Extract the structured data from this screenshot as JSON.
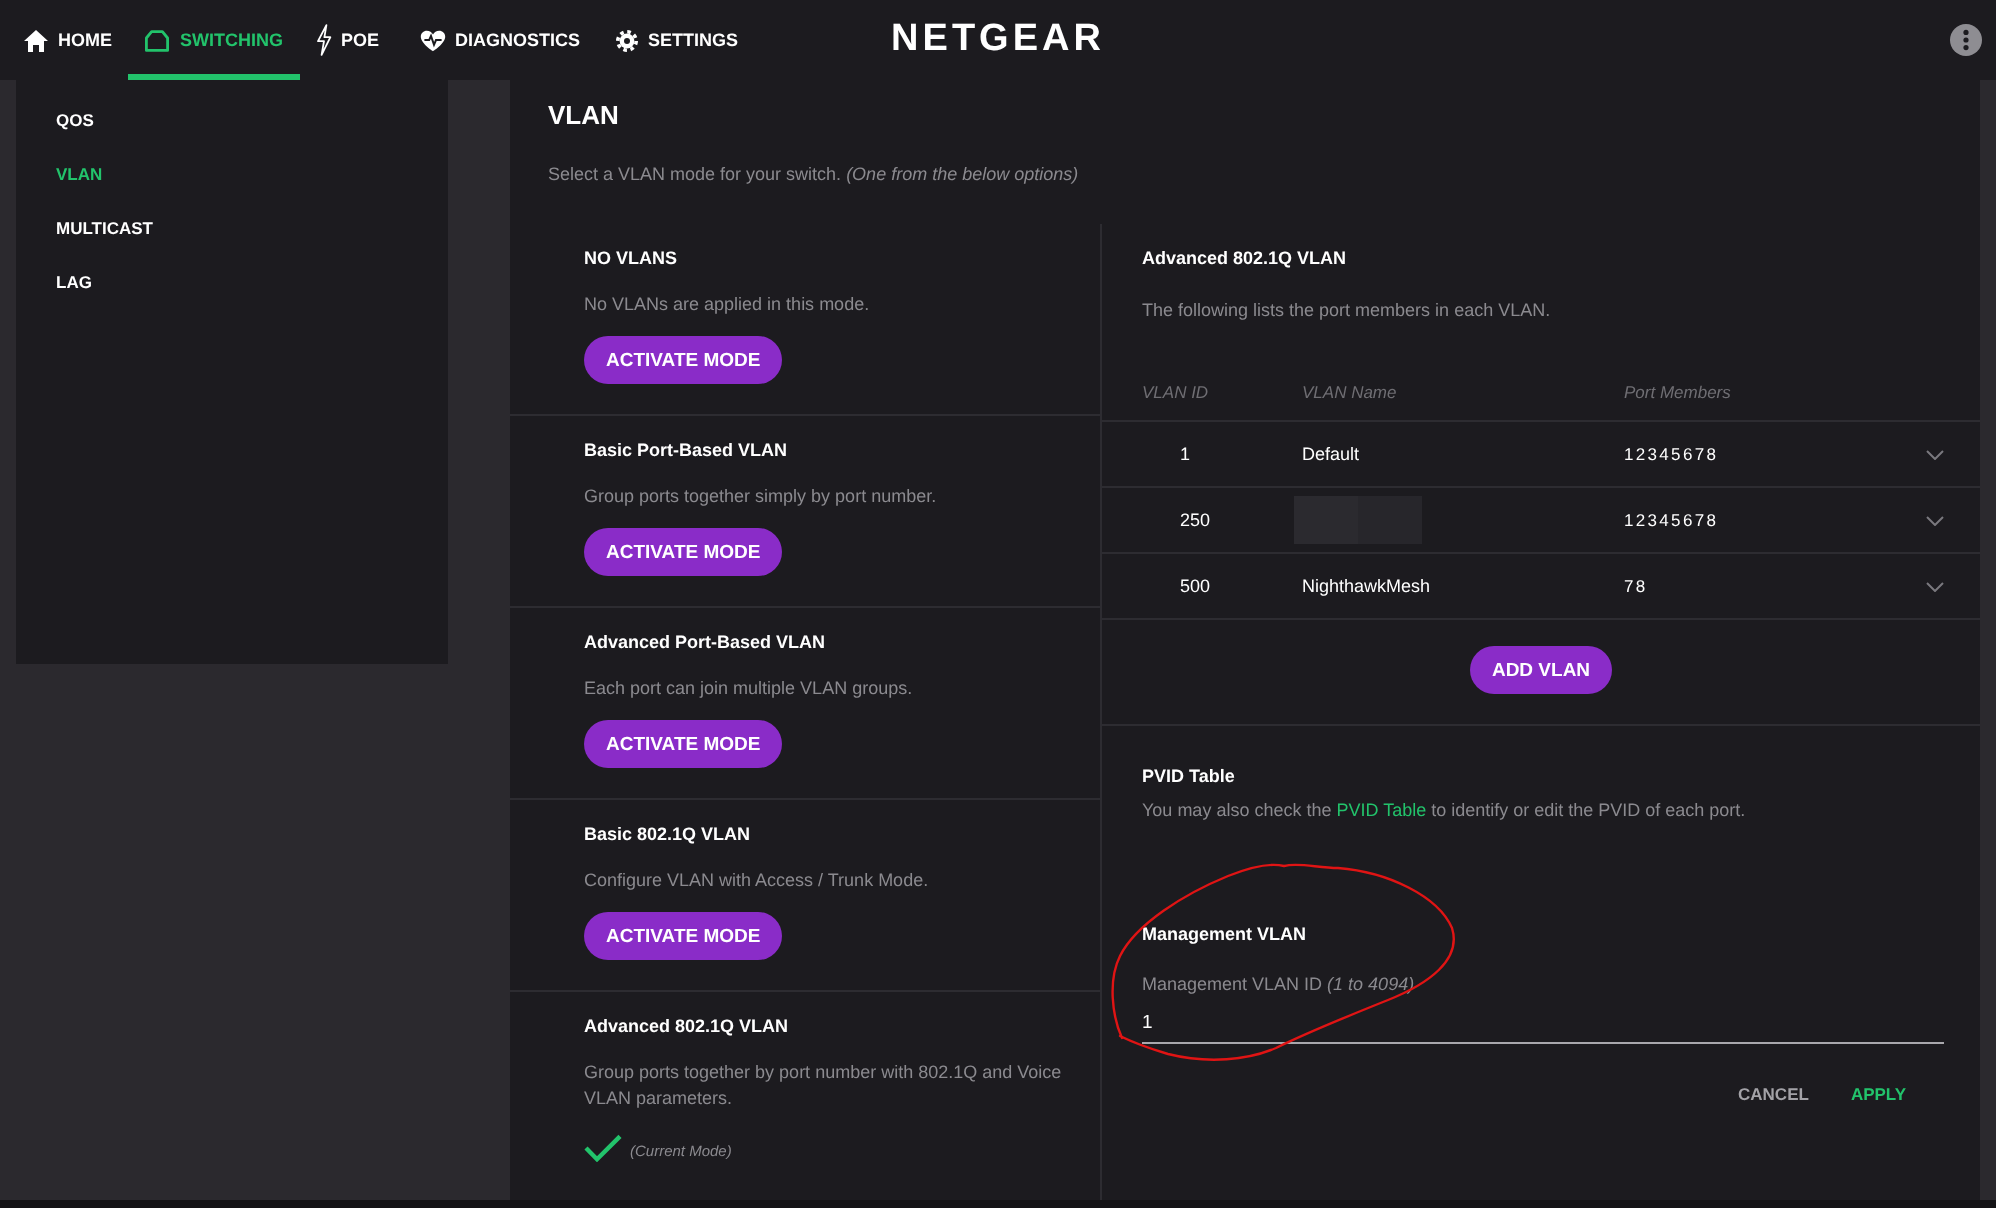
{
  "nav": {
    "tabs": [
      {
        "label": "HOME",
        "selected": false
      },
      {
        "label": "SWITCHING",
        "selected": true
      },
      {
        "label": "POE",
        "selected": false
      },
      {
        "label": "DIAGNOSTICS",
        "selected": false
      },
      {
        "label": "SETTINGS",
        "selected": false
      }
    ],
    "logo": "NETGEAR"
  },
  "sidebar": {
    "items": [
      {
        "label": "QOS",
        "selected": false
      },
      {
        "label": "VLAN",
        "selected": true
      },
      {
        "label": "MULTICAST",
        "selected": false
      },
      {
        "label": "LAG",
        "selected": false
      }
    ]
  },
  "page": {
    "title": "VLAN",
    "intro": "Select a VLAN mode for your switch. *(One from the below options)*"
  },
  "modes": [
    {
      "title": "NO VLANS",
      "description": "No VLANs are applied in this mode.",
      "current": false,
      "button": "ACTIVATE MODE"
    },
    {
      "title": "Basic Port-Based VLAN",
      "description": "Group ports together simply by port number.",
      "current": false,
      "button": "ACTIVATE MODE"
    },
    {
      "title": "Advanced Port-Based VLAN",
      "description": "Each port can join multiple VLAN groups.",
      "current": false,
      "button": "ACTIVATE MODE"
    },
    {
      "title": "Basic 802.1Q VLAN",
      "description": "Configure VLAN with Access / Trunk Mode.",
      "current": false,
      "button": "ACTIVATE MODE"
    },
    {
      "title": "Advanced 802.1Q VLAN",
      "description": "Group ports together by port number with 802.1Q and Voice VLAN parameters.",
      "current": true,
      "current_label": "(Current Mode)"
    }
  ],
  "vlan_table": {
    "title": "Advanced 802.1Q VLAN",
    "description": "The following lists the port members in each VLAN.",
    "columns": [
      "VLAN ID",
      "VLAN Name",
      "Port Members"
    ],
    "rows": [
      {
        "vlan_id": "1",
        "name": "Default",
        "name_hidden": false,
        "ports": "1 2 3 4 5 6 7 8",
        "expanded": false
      },
      {
        "vlan_id": "250",
        "name_hidden": true,
        "ports": "1 2 3 4 5 6 7 8",
        "expanded": false
      },
      {
        "vlan_id": "500",
        "name": "NighthawkMesh",
        "name_hidden": false,
        "ports": "7 8",
        "expanded": false
      }
    ],
    "add_button": "ADD VLAN"
  },
  "pvid": {
    "title": "PVID Table",
    "text_before": "You may also check the ",
    "link": "PVID Table",
    "text_after": " to identify or edit the PVID of each port."
  },
  "management": {
    "title": "Management VLAN",
    "label": "Management VLAN ID *(1 to 4094)*",
    "value": "1"
  },
  "actions": [
    {
      "label": "CANCEL",
      "kind": "cancel"
    },
    {
      "label": "APPLY",
      "kind": "apply"
    }
  ]
}
